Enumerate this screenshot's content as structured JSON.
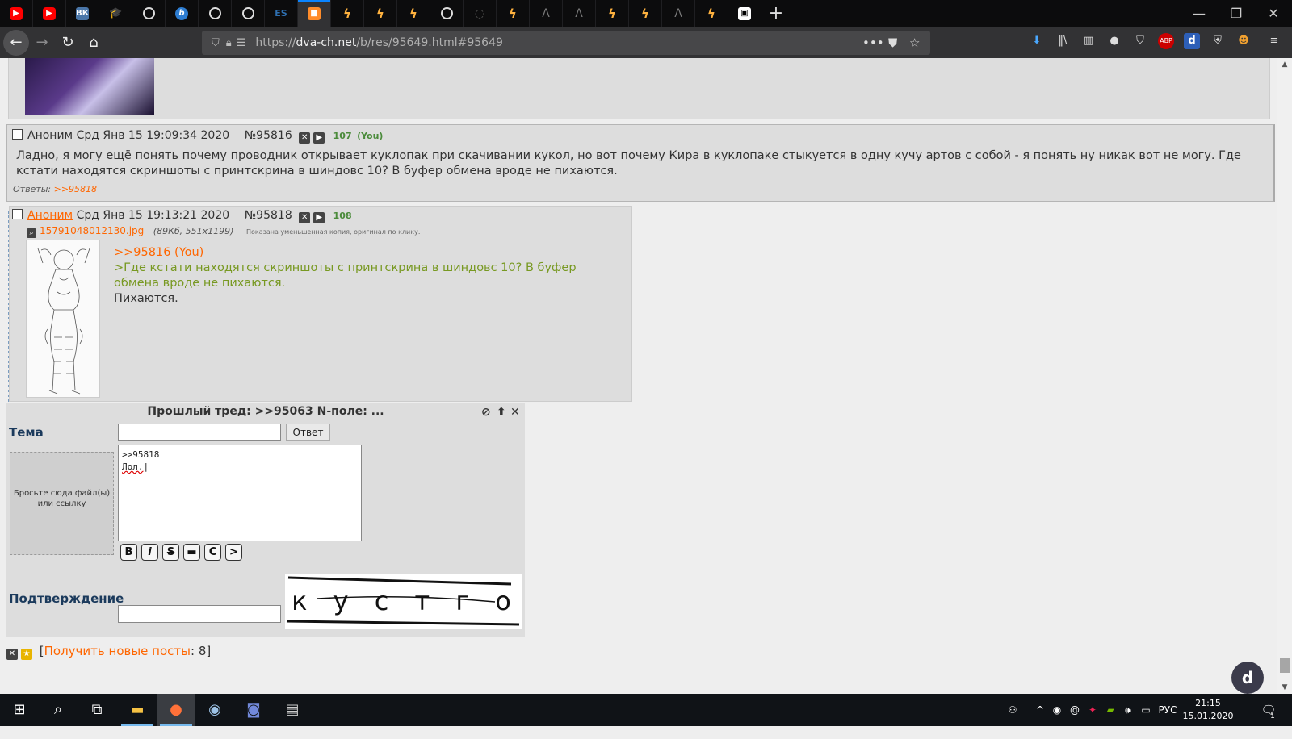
{
  "browser": {
    "url_prefix": "https://",
    "url_host": "dva-ch.net",
    "url_path": "/b/res/95649.html#95649",
    "new_tab_label": "+"
  },
  "posts": [
    {
      "id": "post-95816",
      "name": "Аноним",
      "date": "Срд Янв 15 19:09:34 2020",
      "number": "№95816",
      "count": "107",
      "you": "(You)",
      "text": "Ладно, я могу ещё понять почему проводник открывает куклопак при скачивании кукол, но вот почему Кира в куклопаке стыкуется в одну кучу артов с собой - я понять ну никак вот не могу. Где кстати находятся скриншоты с принтскрина в шиндовс 10? В буфер обмена вроде не пихаются.",
      "replies_label": "Ответы:",
      "replies": ">>95818"
    },
    {
      "id": "post-95818",
      "name": "Аноним",
      "date": "Срд Янв 15 19:13:21 2020",
      "number": "№95818",
      "count": "108",
      "file_name": "15791048012130.jpg",
      "file_meta": "(89Кб, 551x1199)",
      "file_note": "Показана уменьшенная копия, оригинал по клику.",
      "reply_link": ">>95816 (You)",
      "quote": ">Где кстати находятся скриншоты с принтскрина в шиндовс 10? В буфер обмена вроде не пихаются.",
      "body": "Пихаются."
    }
  ],
  "form": {
    "title": "Прошлый тред: >>95063 N-поле: ...",
    "subject_label": "Тема",
    "submit_label": "Ответ",
    "dropzone_text": "Бросьте сюда файл(ы) или ссылку",
    "message_line1": ">>95818",
    "message_line2": "Лол.",
    "markup_buttons": [
      "B",
      "i",
      "S",
      "▬",
      "C",
      ">"
    ],
    "captcha_label": "Подтверждение",
    "captcha_text": "к у с т г о"
  },
  "footer": {
    "bracket_open": "[",
    "get_new_label": "Получить новые посты",
    "get_new_count": ": 8",
    "bracket_close": "]"
  },
  "taskbar": {
    "lang": "РУС",
    "time": "21:15",
    "date": "15.01.2020",
    "notifications": "1"
  }
}
